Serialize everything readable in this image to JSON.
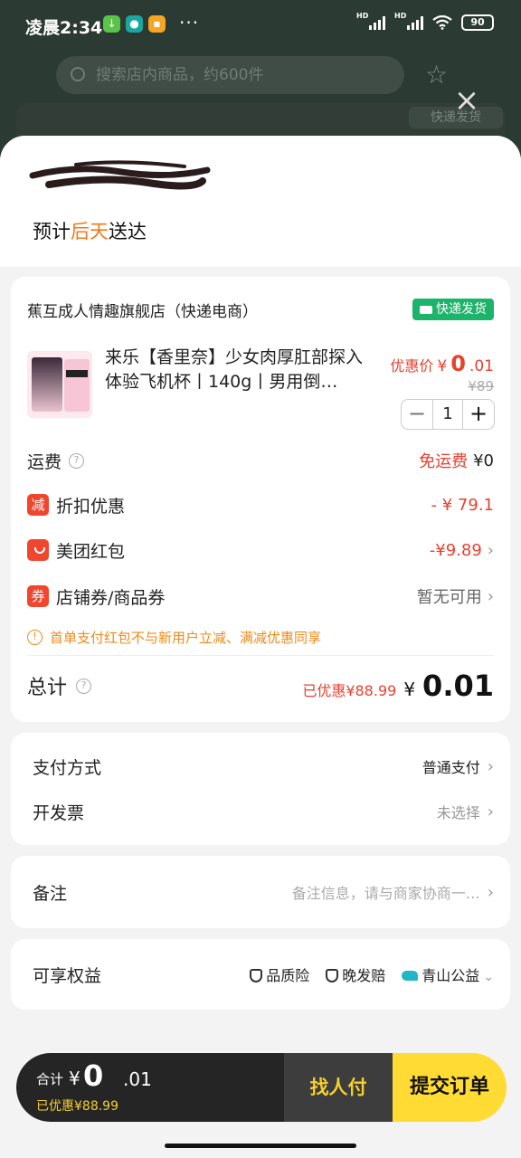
{
  "status_bar": {
    "time": "凌晨2:34",
    "dots": "···",
    "signal_labels": [
      "HD",
      "HD"
    ],
    "battery": "90"
  },
  "background": {
    "search_placeholder": "搜索店内商品，约600件",
    "badge": "快递发货"
  },
  "sheet": {
    "delivery_prefix": "预计",
    "delivery_day": "后天",
    "delivery_suffix": "送达"
  },
  "order": {
    "shop_name": "蕉互成人情趣旗舰店（快递电商）",
    "ship_badge": "快递发货",
    "product_title": "来乐【香里奈】少女肉厚肛部探入体验飞机杯丨140g丨男用倒…",
    "price_label": "优惠价",
    "price_yen": "¥",
    "price_int": "0",
    "price_dec": ".01",
    "original_price": "¥89",
    "quantity": "1",
    "minus": "−",
    "plus": "+",
    "shipping_label": "运费",
    "shipping_tag": "免运费",
    "shipping_value": "¥0",
    "discount_icon": "减",
    "discount_label": "折扣优惠",
    "discount_value": "- ¥ 79.1",
    "redpacket_label": "美团红包",
    "redpacket_value": "-¥9.89",
    "coupon_icon": "券",
    "coupon_label": "店铺券/商品券",
    "coupon_value": "暂无可用",
    "notice": "首单支付红包不与新用户立减、满减优惠同享",
    "total_label": "总计",
    "total_saved": "已优惠¥88.99",
    "total_yen": "¥",
    "total_amount": "0.01"
  },
  "payment": {
    "method_label": "支付方式",
    "method_value": "普通支付",
    "invoice_label": "开发票",
    "invoice_value": "未选择"
  },
  "remark": {
    "label": "备注",
    "placeholder": "备注信息，请与商家协商一…"
  },
  "benefits": {
    "label": "可享权益",
    "items": [
      "品质险",
      "晚发赔",
      "青山公益"
    ]
  },
  "bottom_bar": {
    "sum_label": "合计",
    "yen": "¥",
    "amount_int": "0",
    "amount_dec": ".01",
    "saved": "已优惠¥88.99",
    "find_payer": "找人付",
    "submit": "提交订单"
  },
  "colors": {
    "accent_orange": "#f07a1a",
    "price_red": "#e8412e",
    "ship_green": "#1cb36a",
    "submit_yellow": "#ffdb33"
  }
}
